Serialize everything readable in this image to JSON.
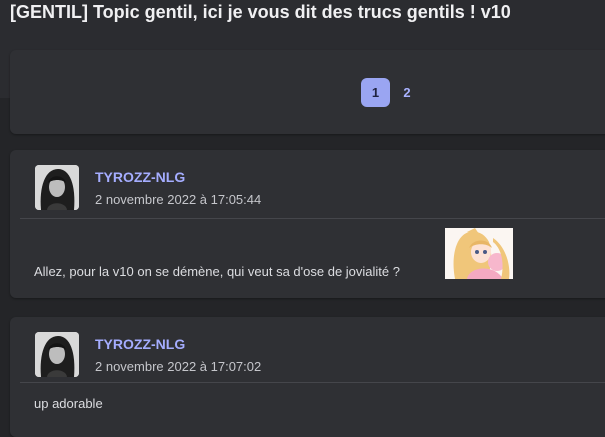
{
  "topic": {
    "title": "[GENTIL] Topic gentil, ici je vous dit des trucs gentils ! v10"
  },
  "pagination": {
    "pages": [
      "1",
      "2"
    ],
    "current": "1"
  },
  "posts": [
    {
      "author": "TYROZZ-NLG",
      "date": "2 novembre 2022 à 17:05:44",
      "message": "Allez, pour la v10 on se démène, qui veut sa d'ose de jovialité ?",
      "sticker": "anime-girl-sticker"
    },
    {
      "author": "TYROZZ-NLG",
      "date": "2 novembre 2022 à 17:07:02",
      "message": "up adorable"
    }
  ],
  "colors": {
    "background": "#242528",
    "card": "#2f3034",
    "accent": "#a5adff",
    "active_page": "#9aa5f2"
  }
}
